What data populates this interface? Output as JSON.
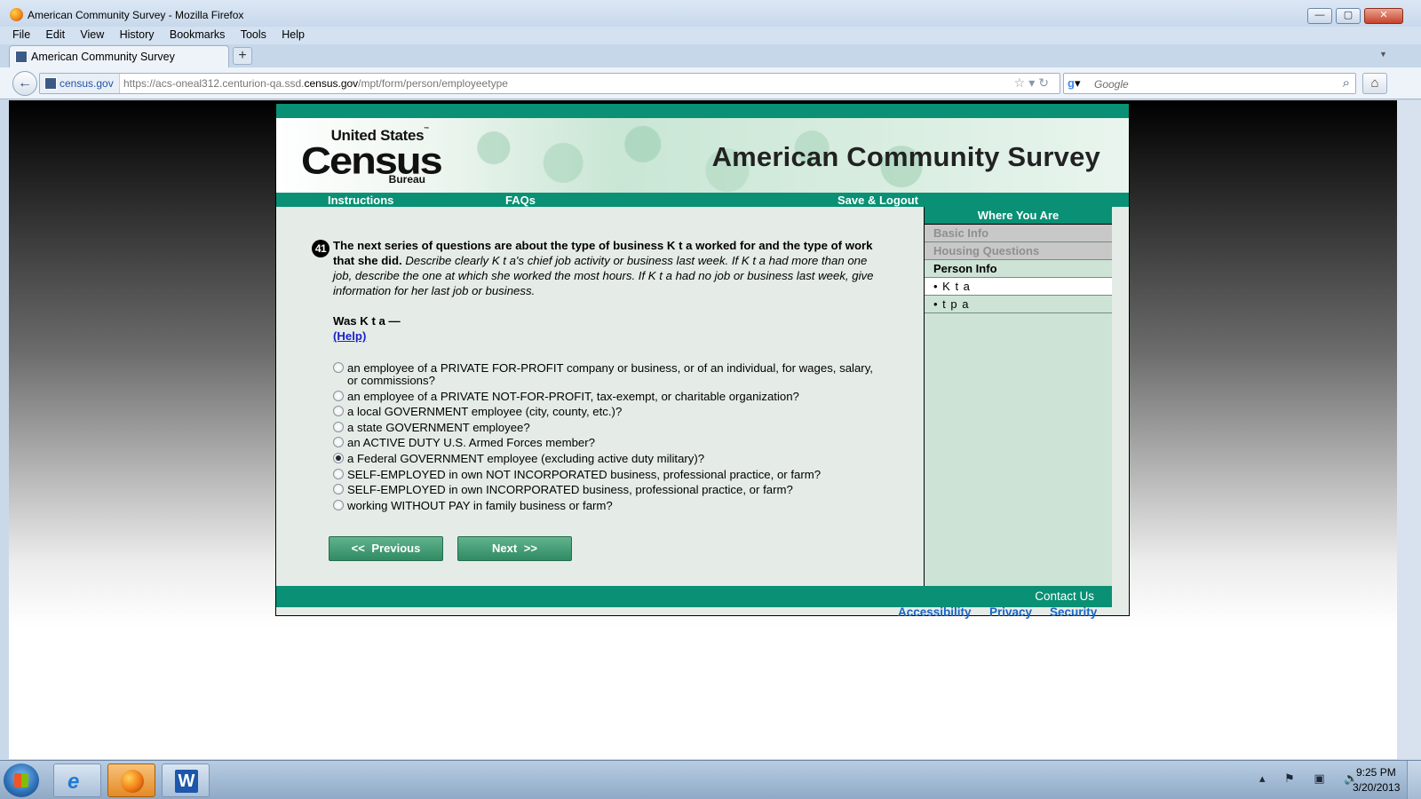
{
  "window": {
    "title": "American Community Survey - Mozilla Firefox",
    "minimize": "—",
    "maximize": "▢",
    "close": "✕"
  },
  "menu": [
    "File",
    "Edit",
    "View",
    "History",
    "Bookmarks",
    "Tools",
    "Help"
  ],
  "tab": {
    "label": "American Community Survey",
    "new_tab": "+"
  },
  "navbar": {
    "identity": "census.gov",
    "url_prefix": "https://acs-oneal312.centurion-qa.ssd.",
    "url_domain": "census.gov",
    "url_suffix": "/mpt/form/person/employeetype",
    "search_placeholder": "Google"
  },
  "census": {
    "logo_line1": "United States",
    "logo_tm": "™",
    "logo_line2": "Census",
    "logo_line3": "Bureau",
    "banner_title": "American Community Survey",
    "nav": {
      "instructions": "Instructions",
      "faqs": "FAQs",
      "save_logout": "Save & Logout"
    },
    "question": {
      "number": "41",
      "bold_text": "The next series of questions are about the type of business K t a worked for and the type of work that she did.",
      "italic_text": "Describe clearly K t a's chief job activity or business last week. If K t a had more than one job, describe the one at which she worked the most hours. If K t a had no job or business last week, give information for her last job or business.",
      "was_label": "Was K t a —",
      "help_link": "(Help)"
    },
    "options": [
      {
        "label": "an employee of a PRIVATE FOR-PROFIT company or business, or of an individual, for wages, salary, or commissions?",
        "checked": false
      },
      {
        "label": "an employee of a PRIVATE NOT-FOR-PROFIT, tax-exempt, or charitable organization?",
        "checked": false
      },
      {
        "label": "a local GOVERNMENT employee (city, county, etc.)?",
        "checked": false
      },
      {
        "label": "a state GOVERNMENT employee?",
        "checked": false
      },
      {
        "label": "an ACTIVE DUTY U.S. Armed Forces member?",
        "checked": false
      },
      {
        "label": "a Federal GOVERNMENT employee (excluding active duty military)?",
        "checked": true
      },
      {
        "label": "SELF-EMPLOYED in own NOT INCORPORATED business, professional practice, or farm?",
        "checked": false
      },
      {
        "label": "SELF-EMPLOYED in own INCORPORATED business, professional practice, or farm?",
        "checked": false
      },
      {
        "label": "working WITHOUT PAY in family business or farm?",
        "checked": false
      }
    ],
    "buttons": {
      "previous": "<< Previous",
      "next": "Next >>"
    },
    "sidebar": {
      "title": "Where You Are",
      "basic_info": "Basic Info",
      "housing": "Housing Questions",
      "person_info": "Person Info",
      "person_current": "• K t a",
      "person_other": "• t p a"
    },
    "footer": {
      "contact_us": "Contact Us"
    },
    "links": {
      "accessibility": "Accessibility",
      "privacy": "Privacy",
      "security": "Security"
    }
  },
  "taskbar": {
    "ie_glyph": "e",
    "word_glyph": "W",
    "tray_icons": [
      "chevron-up-icon",
      "flag-icon",
      "network-icon",
      "speaker-icon"
    ],
    "tray_glyphs": "▴ ⚑ ▣ 🔊",
    "time": "9:25 PM",
    "date": "3/20/2013"
  }
}
